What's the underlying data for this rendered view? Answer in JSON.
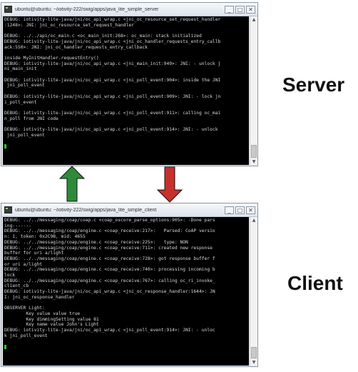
{
  "server": {
    "title": "ubuntu@ubuntu: ~/iotivity-222/swig/apps/java_lite_simple_server",
    "lines": [
      "DEBUG: iotivity-lite-java/jni/oc_api_wrap.c <jni_oc_resource_set_request_handler",
      ":1248>: JNI: jni_oc_resource_set_request_handler",
      "",
      "DEBUG: ../../api/oc_main.c <oc_main_init:268>: oc_main: stack initialized",
      "DEBUG: iotivity-lite-java/jni/oc_api_wrap.c <jni_oc_handler_requests_entry_callb",
      "ack:550>: JNI: jni_oc_handler_requests_entry_callback",
      "",
      "inside MyInitHandler.requestEntry()",
      "DEBUG: iotivity-lite-java/jni/oc_api_wrap.c <jni_main_init:949>: JNI: - unlock j",
      "ni_main_init",
      "",
      "DEBUG: iotivity-lite-java/jni/oc_api_wrap.c <jni_poll_event:904>: inside the JNI",
      " jni_poll_event",
      "",
      "DEBUG: iotivity-lite-java/jni/oc_api_wrap.c <jni_poll_event:909>: JNI: - lock jn",
      "i_poll_event",
      "",
      "DEBUG: iotivity-lite-java/jni/oc_api_wrap.c <jni_poll_event:911>: calling oc_mai",
      "n_poll from JNI code",
      "",
      "DEBUG: iotivity-lite-java/jni/oc_api_wrap.c <jni_poll_event:914>: JNI: - unlock",
      " jni_poll_event"
    ]
  },
  "client": {
    "title": "ubuntu@ubuntu: ~/iotivity-222/swig/apps/java_lite_simple_client",
    "lines": [
      "DEBUG: ../../messaging/coap/coap.c <coap_oscore_parse_options:905>: -Done pars",
      "ing-------",
      "DEBUG: ../../messaging/coap/engine.c <coap_receive:217>:   Parsed: CoAP versio",
      "n: 1, token: 0x2C9B, mid: 4655",
      "DEBUG: ../../messaging/coap/engine.c <coap_receive:225>:   type: NON",
      "DEBUG: ../../messaging/coap/engine.c <coap_receive:711>: created new response",
      "buffer for uri a/light",
      "DEBUG: ../../messaging/coap/engine.c <coap_receive:728>: got response buffer f",
      "or uri a/light",
      "DEBUG: ../../messaging/coap/engine.c <coap_receive:740>: processing incoming b",
      "lock",
      "DEBUG: ../../messaging/coap/engine.c <coap_receive:767>: calling oc_ri_invoke_",
      "client_cb",
      "DEBUG: iotivity-lite-java/jni/oc_api_wrap.c <jni_oc_response_handler:1644>: JN",
      "I: jni_oc_response_handler",
      "",
      "OBSERVER Light:",
      "        Key value value true",
      "        Key dimmingSetting value 81",
      "        Key name value John's Light",
      "DEBUG: iotivity-lite-java/jni/oc_api_wrap.c <jni_poll_event:914>: JNI: - unloc",
      "k jni_poll_event"
    ]
  },
  "labels": {
    "server": "Server",
    "client": "Client"
  },
  "window_buttons": {
    "minimize": "_",
    "maximize": "□",
    "close": "✕"
  },
  "arrows": {
    "up_color": "#2e8b3a",
    "down_color": "#c8302c"
  }
}
